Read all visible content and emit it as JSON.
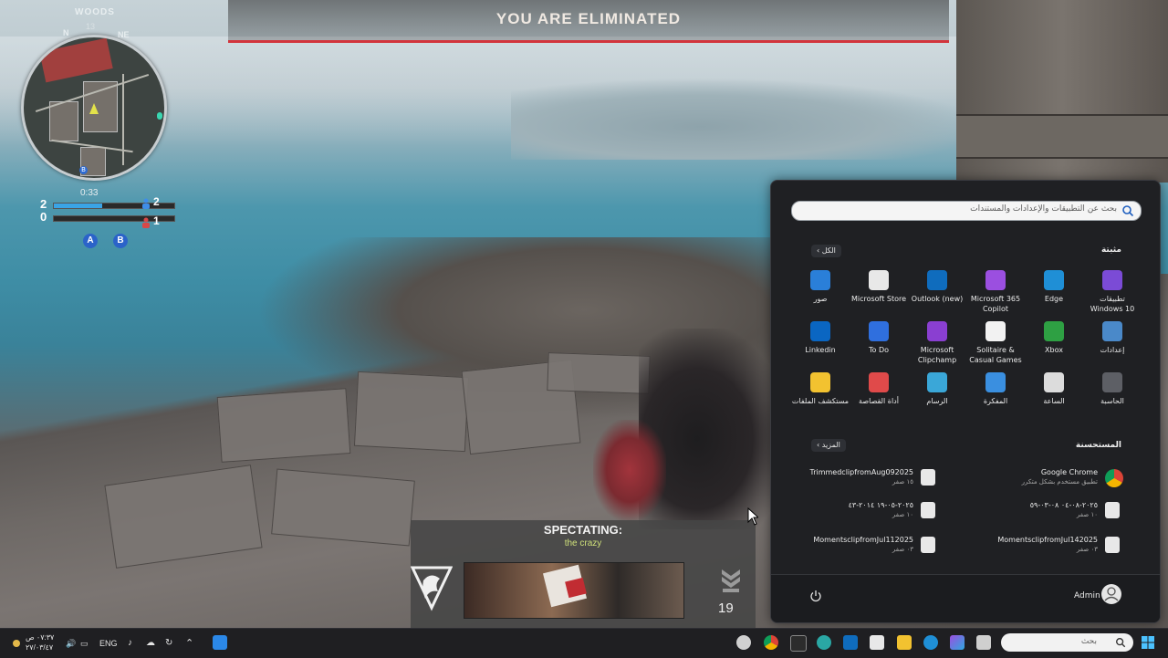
{
  "game": {
    "banner": "YOU ARE ELIMINATED",
    "minimap": {
      "location": "WOODS",
      "heading": "13",
      "compass_n": "N",
      "compass_ne": "NE",
      "b_marker": "B",
      "timer": "0:33"
    },
    "score": {
      "friendly": "2",
      "enemy": "0",
      "friendly_alive": "2",
      "enemy_alive": "1",
      "friendly_progress": 0.4,
      "enemy_progress": 0.0
    },
    "objectives": [
      "A",
      "B"
    ],
    "spectate": {
      "title": "SPECTATING:",
      "player": "the crazy",
      "rank": "19"
    }
  },
  "start_menu": {
    "search_placeholder": "بحث عن التطبيقات والإعدادات والمستندات",
    "pinned_title": "مثبتة",
    "all_button": "الكل",
    "pinned": [
      {
        "label": "تطبيقات Windows 10",
        "icon": "windows10-apps-icon",
        "color": "#7b4bd6"
      },
      {
        "label": "Edge",
        "icon": "edge-icon",
        "color": "#1f8fd6"
      },
      {
        "label": "Microsoft 365 Copilot",
        "icon": "m365-copilot-icon",
        "color": "#9b4fe0"
      },
      {
        "label": "Outlook (new)",
        "icon": "outlook-icon",
        "color": "#0f6cbd"
      },
      {
        "label": "Microsoft Store",
        "icon": "store-icon",
        "color": "#e8e8e8"
      },
      {
        "label": "صور",
        "icon": "photos-icon",
        "color": "#2a7fd9"
      },
      {
        "label": "إعدادات",
        "icon": "settings-icon",
        "color": "#4a89c9"
      },
      {
        "label": "Xbox",
        "icon": "xbox-icon",
        "color": "#2ea043"
      },
      {
        "label": "Solitaire & Casual Games",
        "icon": "solitaire-icon",
        "color": "#f2f2f2"
      },
      {
        "label": "Microsoft Clipchamp",
        "icon": "clipchamp-icon",
        "color": "#8a3fd1"
      },
      {
        "label": "To Do",
        "icon": "todo-icon",
        "color": "#2f6fde"
      },
      {
        "label": "Linkedin",
        "icon": "linkedin-icon",
        "color": "#0a66c2"
      },
      {
        "label": "الحاسبة",
        "icon": "calculator-icon",
        "color": "#5d5f65"
      },
      {
        "label": "الساعة",
        "icon": "clock-icon",
        "color": "#dcdcdc"
      },
      {
        "label": "المفكرة",
        "icon": "notepad-icon",
        "color": "#3a8fe0"
      },
      {
        "label": "الرسام",
        "icon": "paint-icon",
        "color": "#3aa7d8"
      },
      {
        "label": "أداة القصاصة",
        "icon": "snipping-tool-icon",
        "color": "#e04a4a"
      },
      {
        "label": "مستكشف الملفات",
        "icon": "file-explorer-icon",
        "color": "#f2c230"
      }
    ],
    "recommended_title": "المستحسنة",
    "more_button": "المزيد",
    "recommended": [
      {
        "name": "Google Chrome",
        "sub": "تطبيق مستخدم بشكل متكرر",
        "icon": "chrome-icon"
      },
      {
        "name": "TrimmedclipfromAug092025",
        "sub": "١٥ صفر",
        "icon": "video-file-icon"
      },
      {
        "name": "٢٠٢٥-٠٨-٠٤ ٠٨-٠٣-٥٩",
        "sub": "١٠ صفر",
        "icon": "video-file-icon"
      },
      {
        "name": "٢٠٢٥-٠٥-١٩ ٢٠١٤-٤٣",
        "sub": "١٠ صفر",
        "icon": "video-file-icon"
      },
      {
        "name": "MomentsclipfromJul142025",
        "sub": "٠٣ صفر",
        "icon": "video-file-icon"
      },
      {
        "name": "MomentsclipfromJul112025",
        "sub": "٠٣ صفر",
        "icon": "video-file-icon"
      }
    ],
    "user": "Admin"
  },
  "taskbar": {
    "time": "٠٧:٣٧ ص",
    "date": "٢٧/٠٣/٤٧",
    "language": "ENG",
    "search_placeholder": "بحث"
  }
}
